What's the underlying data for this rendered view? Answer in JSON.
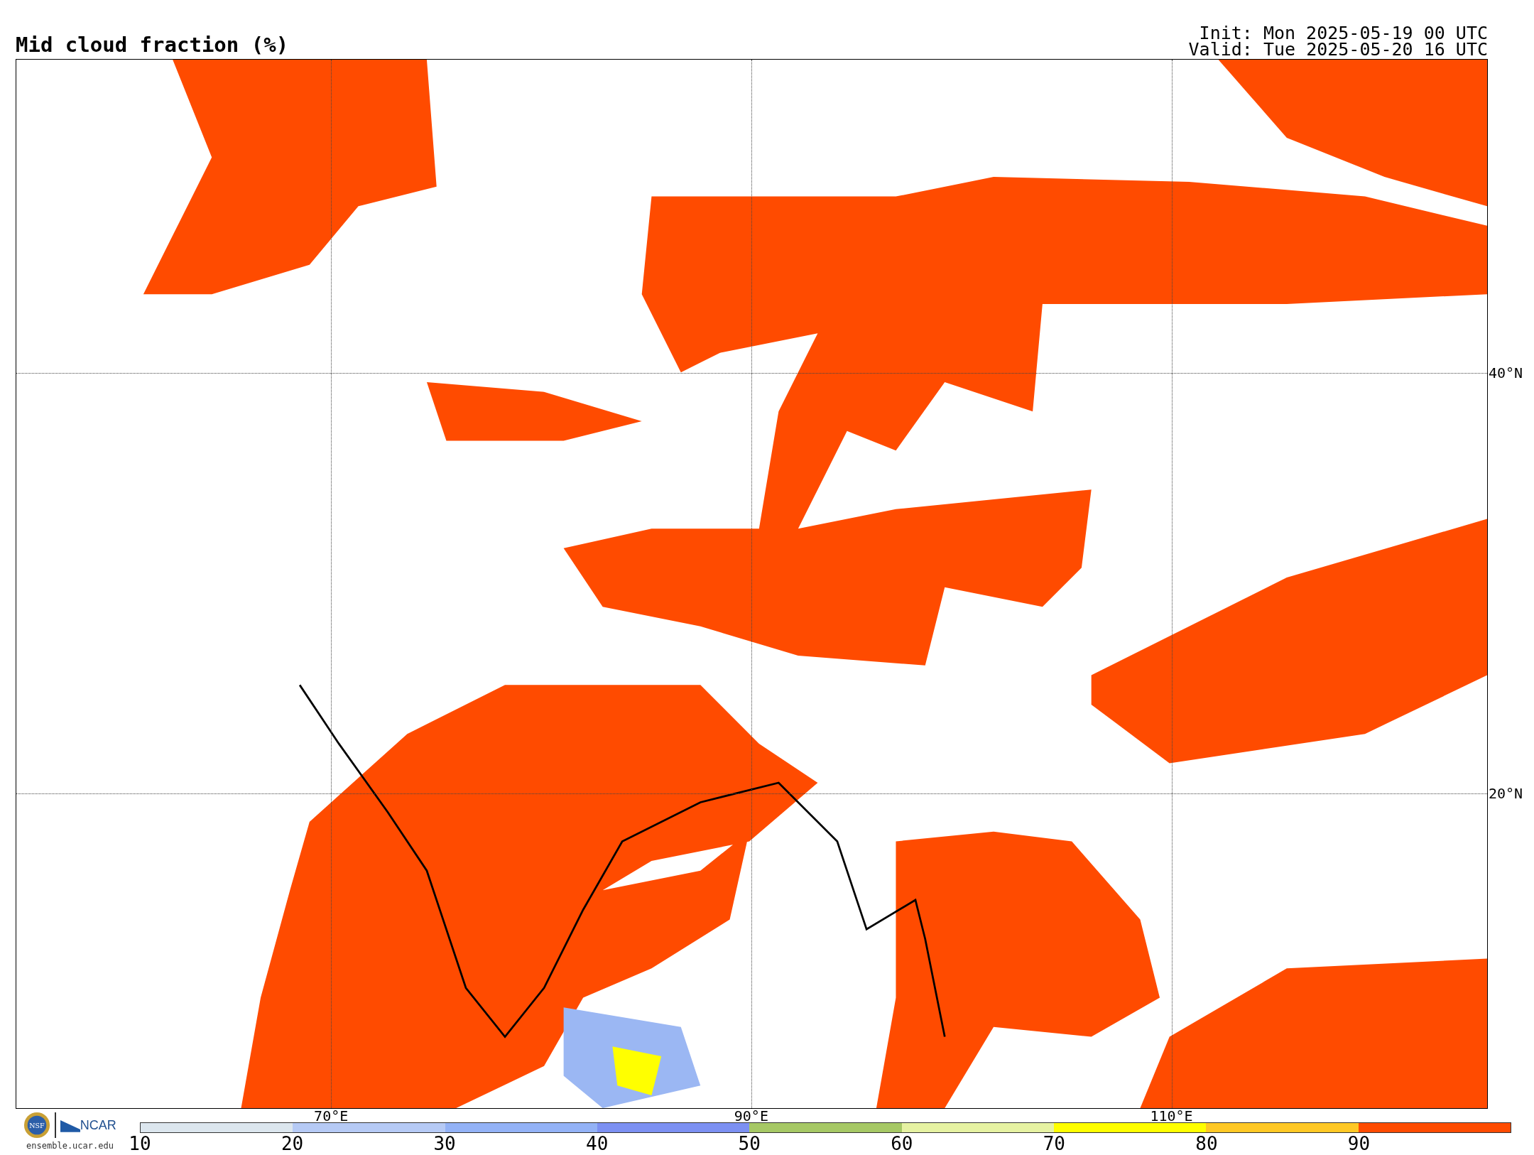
{
  "title": "Mid cloud fraction (%)",
  "init": "Init: Mon 2025-05-19 00 UTC",
  "valid": "Valid: Tue 2025-05-20 16 UTC",
  "map": {
    "longitudes": [
      "70°E",
      "90°E",
      "110°E"
    ],
    "latitudes": [
      "40°N",
      "20°N"
    ]
  },
  "colorbar": [
    {
      "label": "10",
      "color": "#dce6ee"
    },
    {
      "label": "20",
      "color": "#b6caf5"
    },
    {
      "label": "30",
      "color": "#93b2f6"
    },
    {
      "label": "40",
      "color": "#7c90f2"
    },
    {
      "label": "50",
      "color": "#a6c865"
    },
    {
      "label": "60",
      "color": "#e6f2a2"
    },
    {
      "label": "70",
      "color": "#ffff00"
    },
    {
      "label": "80",
      "color": "#ffc825"
    },
    {
      "label": "90",
      "color": "#ff4b00"
    }
  ],
  "credits": {
    "nsf": "NSF",
    "ncar": "NCAR",
    "site": "ensemble.ucar.edu"
  }
}
